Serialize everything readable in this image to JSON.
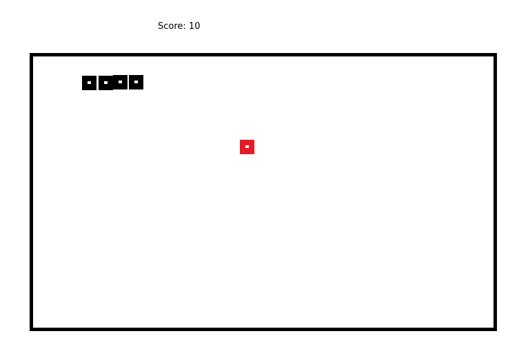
{
  "hud": {
    "score_label": "Score: 10"
  },
  "colors": {
    "background": "#ffffff",
    "board_border": "#000000",
    "snake": "#000000",
    "food": "#e31c25",
    "segment_dot": "#ffffff"
  },
  "game": {
    "snake_length": 4
  }
}
